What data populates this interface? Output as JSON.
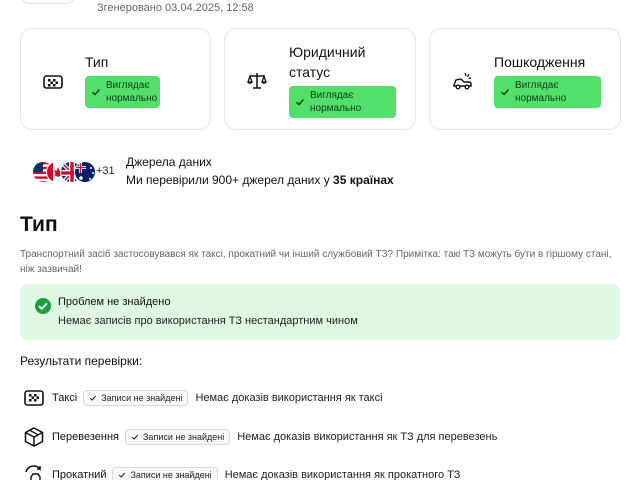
{
  "header": {
    "generated": "Згенеровано 03.04.2025, 12:58"
  },
  "cards": [
    {
      "title": "Тип",
      "badge": "Виглядає нормально",
      "icon": "taxi-icon"
    },
    {
      "title": "Юридичний статус",
      "badge": "Виглядає нормально",
      "icon": "scales-icon"
    },
    {
      "title": "Пошкодження",
      "badge": "Виглядає нормально",
      "icon": "crashed-car-icon"
    }
  ],
  "sources": {
    "flags": [
      "us-flag",
      "ca-flag",
      "uk-flag",
      "au-flag"
    ],
    "more_count": "+31",
    "title": "Джерела даних",
    "subtitle_prefix": "Ми перевірили 900+ джерел даних у ",
    "subtitle_bold": "35 країнах"
  },
  "section": {
    "title": "Тип",
    "description": "Транспортний засіб застосовувався як таксі, прокатний чи інший службовий ТЗ? Примітка: такі ТЗ можуть бути в гіршому стані, ніж зазвичай!"
  },
  "ok_box": {
    "title": "Проблем не знайдено",
    "text": "Немає записів про використання ТЗ нестандартним чином"
  },
  "results": {
    "title": "Результати перевірки:",
    "rows": [
      {
        "label": "Таксі",
        "badge": "Записи не знайдені",
        "text": "Немає доказів використання як таксі",
        "icon": "taxi-icon"
      },
      {
        "label": "Перевезення",
        "badge": "Записи не знайдені",
        "text": "Немає доказів використання як ТЗ для перевезень",
        "icon": "package-icon"
      },
      {
        "label": "Прокатний",
        "badge": "Записи не знайдені",
        "text": "Немає доказів використання як прокатного ТЗ",
        "icon": "rental-icon"
      }
    ]
  },
  "colors": {
    "badge_green": "#52e06b",
    "ok_box_bg": "#def8e2",
    "check_green": "#1a9e3a"
  }
}
